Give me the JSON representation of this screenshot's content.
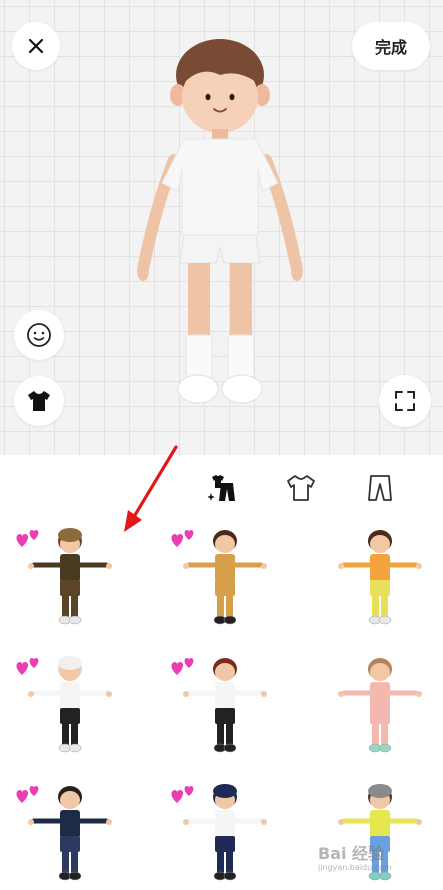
{
  "header": {
    "done_label": "完成"
  },
  "icons": {
    "close": "close-icon",
    "face": "face-icon",
    "outfit": "tshirt-icon",
    "fullscreen": "fullscreen-icon"
  },
  "tabs": [
    {
      "id": "all",
      "icon": "outfit-set-icon",
      "selected": true
    },
    {
      "id": "top",
      "icon": "tshirt-outline-icon",
      "selected": false
    },
    {
      "id": "bottom",
      "icon": "pants-icon",
      "selected": false
    }
  ],
  "outfits": [
    {
      "hair": "#6b4a2e",
      "hat": "#8c6a3a",
      "skin": "#f1c7a6",
      "top": "#4b3a22",
      "bottom": "#5c4428",
      "shoes": "#e8e8e8",
      "liked": true
    },
    {
      "hair": "#4a2b1a",
      "hat": "",
      "skin": "#f1c7a6",
      "top": "#d6a04a",
      "bottom": "#d6a04a",
      "shoes": "#222222",
      "liked": true
    },
    {
      "hair": "#4a2b1a",
      "hat": "",
      "skin": "#f1c7a6",
      "top": "#f4a23c",
      "bottom": "#e8e05a",
      "shoes": "#e8e8e8",
      "liked": false
    },
    {
      "hair": "#d8d8d8",
      "hat": "#f0f0f0",
      "skin": "#f1c7a6",
      "top": "#f5f5f5",
      "bottom": "#222222",
      "shoes": "#e8e8e8",
      "liked": true
    },
    {
      "hair": "#7a2b1e",
      "hat": "",
      "skin": "#f1c7a6",
      "top": "#f5f5f5",
      "bottom": "#222222",
      "shoes": "#222222",
      "liked": true
    },
    {
      "hair": "#b5845a",
      "hat": "",
      "skin": "#f1c7a6",
      "top": "#f3b8b0",
      "bottom": "#f3b8b0",
      "shoes": "#9ad6c0",
      "liked": false
    },
    {
      "hair": "#222222",
      "hat": "",
      "skin": "#f1c7a6",
      "top": "#1f2a44",
      "bottom": "#2b3a5e",
      "shoes": "#222222",
      "liked": true
    },
    {
      "hair": "#1f2a56",
      "hat": "#1f2a56",
      "skin": "#f1c7a6",
      "top": "#f5f5f5",
      "bottom": "#1f2a56",
      "shoes": "#222222",
      "liked": true
    },
    {
      "hair": "#444444",
      "hat": "#8a8a8a",
      "skin": "#f1c7a6",
      "top": "#e6e650",
      "bottom": "#6aa0e0",
      "shoes": "#7fd0c0",
      "liked": false
    }
  ],
  "watermark": {
    "text": "Bai 经验",
    "sub": "jingyan.baidu.com"
  }
}
